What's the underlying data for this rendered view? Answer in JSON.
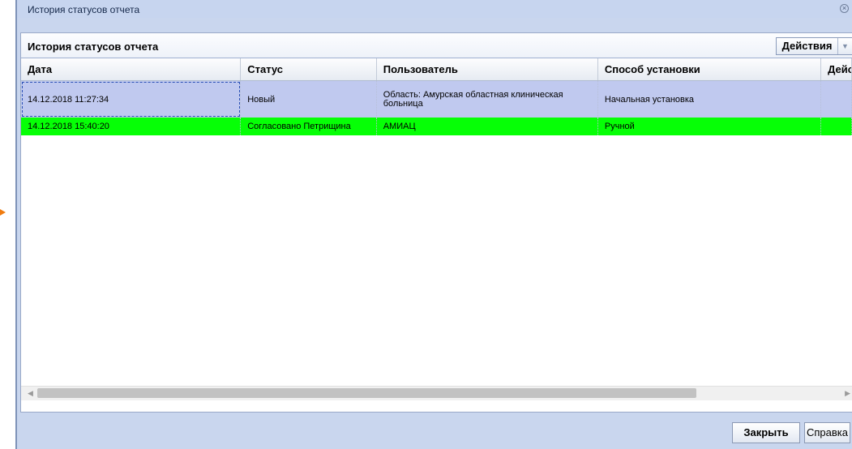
{
  "window": {
    "title": "История статусов отчета"
  },
  "panel": {
    "title": "История статусов отчета",
    "actions_label": "Действия"
  },
  "grid": {
    "columns": [
      "Дата",
      "Статус",
      "Пользователь",
      "Способ установки",
      "Дейс"
    ],
    "rows": [
      {
        "date": "14.12.2018 11:27:34",
        "status": "Новый",
        "user": "Область: Амурская областная клиническая больница",
        "method": "Начальная установка",
        "action": ""
      },
      {
        "date": "14.12.2018 15:40:20",
        "status": "Согласовано Петрищина",
        "user": "АМИАЦ",
        "method": "Ручной",
        "action": ""
      }
    ]
  },
  "footer": {
    "close_label": "Закрыть",
    "help_label": "Справка"
  },
  "icons": {
    "close": "close-icon",
    "dropdown": "chevron-down-icon",
    "scroll_left": "arrow-left-icon",
    "scroll_right": "arrow-right-icon"
  },
  "colors": {
    "selected_row": "#c0c9ef",
    "approved_row": "#06ff06",
    "window_bg": "#c9d6ee",
    "accent_arrow": "#f07c10"
  }
}
